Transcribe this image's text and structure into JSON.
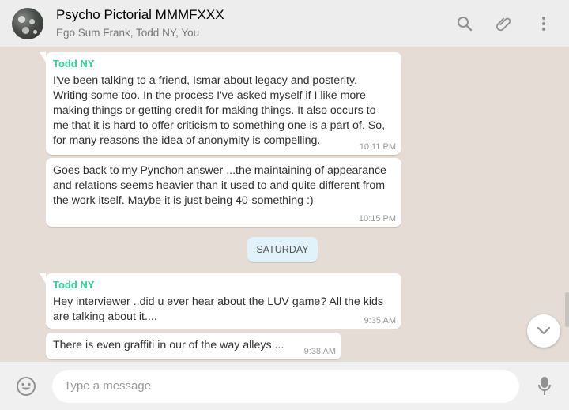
{
  "header": {
    "title": "Psycho Pictorial MMMFXXX",
    "subtitle": "Ego Sum Frank, Todd NY, You",
    "icons": [
      "search-icon",
      "paperclip-icon",
      "menu-dots-icon"
    ]
  },
  "messages": [
    {
      "sender": "Todd NY",
      "text": "I've been talking to a friend, Ismar about legacy and posterity. Writing some too. In the process I've asked myself if I like more making things or getting credit for making things. It also occurs to me that it is hard to offer criticism to something one is a part of. So, for many reasons the idea of anonymity is compelling.",
      "time": "10:11 PM"
    },
    {
      "text": "Goes back to my Pynchon answer ...the maintaining of appearance and relations seems heavier than it used to and quite different from the work itself. Maybe it is just being 40-something :)",
      "time": "10:15 PM"
    },
    {
      "sender": "Todd NY",
      "text": "Hey interviewer ..did u ever hear about the LUV game? All the kids are talking about it....",
      "time": "9:35 AM"
    },
    {
      "text": "There is even graffiti in our of the way alleys ...",
      "time": "9:38 AM"
    }
  ],
  "day_divider": "SATURDAY",
  "composer": {
    "placeholder": "Type a message"
  },
  "colors": {
    "sender_name": "#35cd96",
    "chat_background": "#e5ddd5",
    "day_pill": "#e1f2fb",
    "header_background": "#ededed"
  }
}
